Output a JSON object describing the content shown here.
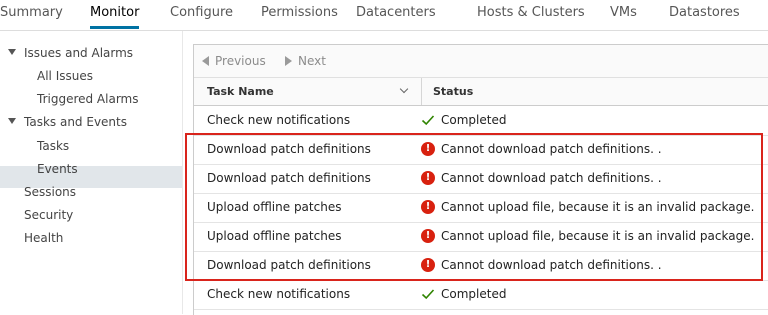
{
  "tabs": [
    "Summary",
    "Monitor",
    "Configure",
    "Permissions",
    "Datacenters",
    "Hosts & Clusters",
    "VMs",
    "Datastores"
  ],
  "active_tab": "Monitor",
  "nav": {
    "issues_and_alarms": "Issues and Alarms",
    "all_issues": "All Issues",
    "triggered_alarms": "Triggered Alarms",
    "tasks_and_events": "Tasks and Events",
    "tasks": "Tasks",
    "events": "Events",
    "sessions": "Sessions",
    "security": "Security",
    "health": "Health",
    "selected": "Tasks"
  },
  "pager": {
    "previous": "Previous",
    "next": "Next"
  },
  "columns": {
    "task_name": "Task Name",
    "status": "Status"
  },
  "rows": [
    {
      "task": "Check new notifications",
      "status": "Completed",
      "type": "ok"
    },
    {
      "task": "Download patch definitions",
      "status": "Cannot download patch definitions. .",
      "type": "error"
    },
    {
      "task": "Download patch definitions",
      "status": "Cannot download patch definitions. .",
      "type": "error"
    },
    {
      "task": "Upload offline patches",
      "status": "Cannot upload file, because it is an invalid package.",
      "type": "error"
    },
    {
      "task": "Upload offline patches",
      "status": "Cannot upload file, because it is an invalid package.",
      "type": "error"
    },
    {
      "task": "Download patch definitions",
      "status": "Cannot download patch definitions. .",
      "type": "error"
    },
    {
      "task": "Check new notifications",
      "status": "Completed",
      "type": "ok"
    }
  ],
  "colors": {
    "accent": "#0072a3",
    "error": "#d8210f",
    "success": "#2f8400",
    "highlight": "#d9241c"
  }
}
